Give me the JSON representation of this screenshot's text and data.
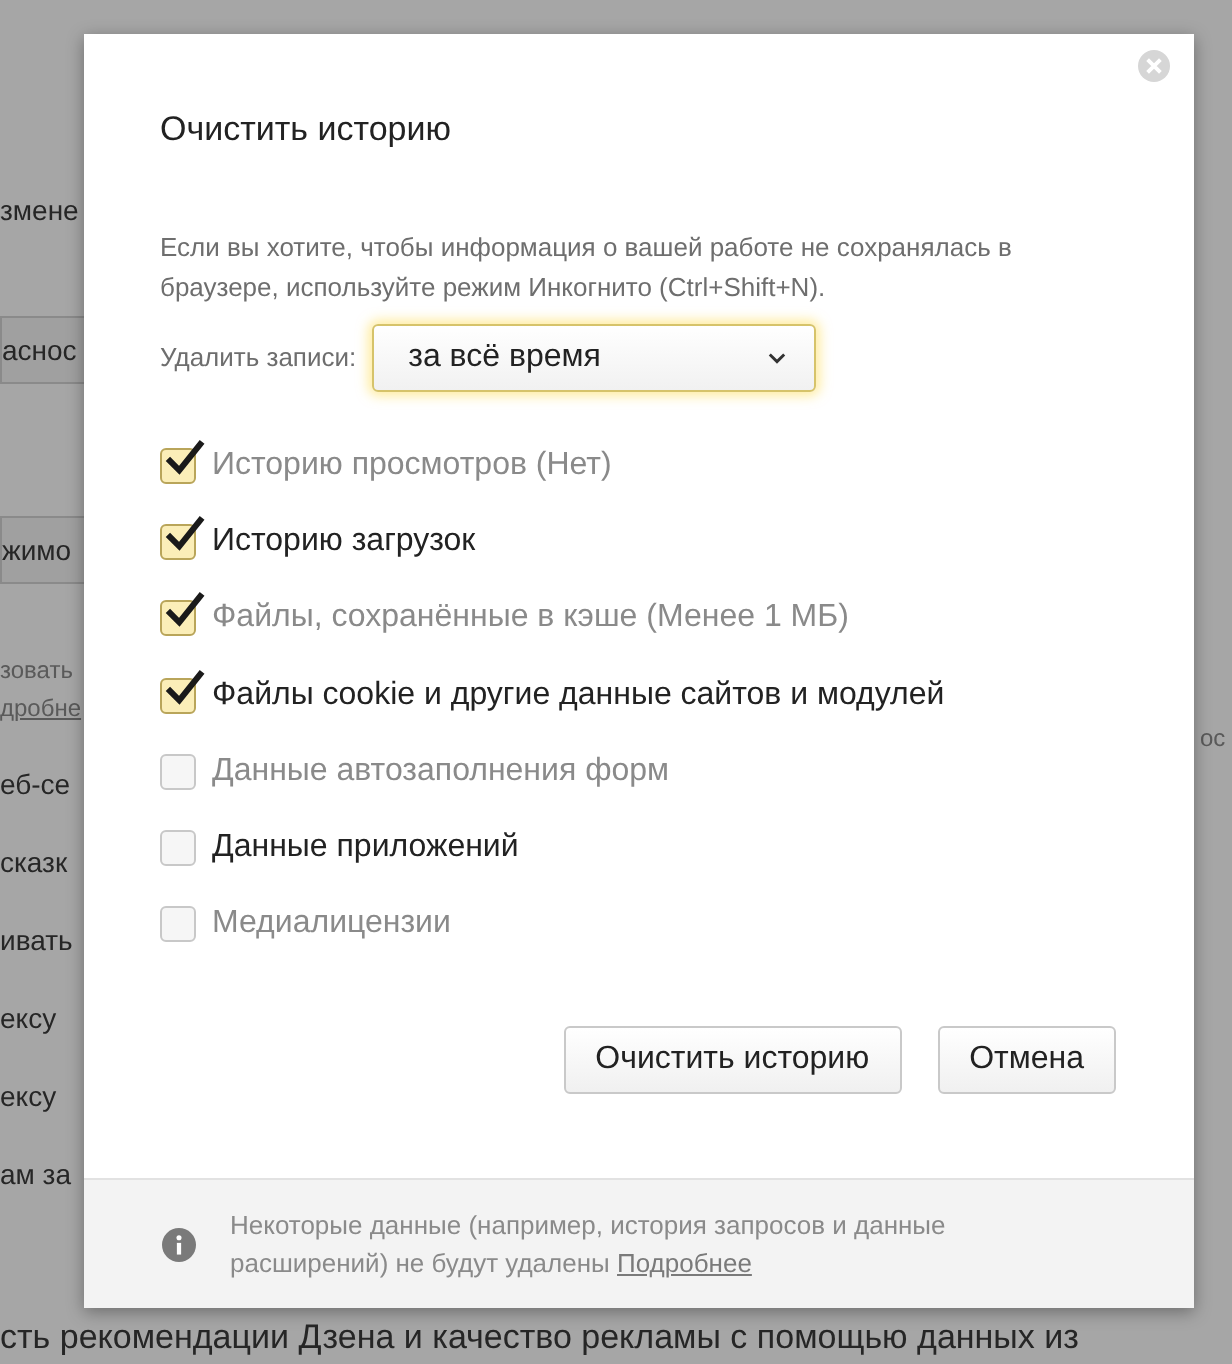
{
  "background": {
    "left_texts": [
      {
        "kind": "text",
        "text": "змене"
      },
      {
        "kind": "button",
        "text": "аснос"
      },
      {
        "kind": "button",
        "text": "жимо"
      },
      {
        "kind": "hint",
        "text": "зовать"
      },
      {
        "kind": "link",
        "text": "дробне"
      },
      {
        "kind": "text",
        "text": "еб-се"
      },
      {
        "kind": "text",
        "text": "сказк"
      },
      {
        "kind": "text",
        "text": "ивать"
      },
      {
        "kind": "text",
        "text": "ексу"
      },
      {
        "kind": "text",
        "text": "ексу"
      },
      {
        "kind": "text",
        "text": "ам за"
      }
    ],
    "right_text": "ос",
    "bottom_text": "сть рекомендации Дзена и качество рекламы с помощью данных из"
  },
  "dialog": {
    "title": "Очистить историю",
    "info": "Если вы хотите, чтобы информация о вашей работе не сохранялась в браузере, используйте режим Инкогнито (Ctrl+Shift+N).",
    "range_label": "Удалить записи:",
    "range_value": "за всё время",
    "items": [
      {
        "label": "Историю просмотров (Нет)",
        "checked": true,
        "dimmed": true
      },
      {
        "label": "Историю загрузок",
        "checked": true,
        "dimmed": false
      },
      {
        "label": "Файлы, сохранённые в кэше (Менее 1 МБ)",
        "checked": true,
        "dimmed": true
      },
      {
        "label": "Файлы cookie и другие данные сайтов и модулей",
        "checked": true,
        "dimmed": false
      },
      {
        "label": "Данные автозаполнения форм",
        "checked": false,
        "dimmed": true
      },
      {
        "label": "Данные приложений",
        "checked": false,
        "dimmed": false
      },
      {
        "label": "Медиалицензии",
        "checked": false,
        "dimmed": true
      }
    ],
    "buttons": [
      "Очистить историю",
      "Отмена"
    ],
    "footer": {
      "text": "Некоторые данные (например, история запросов и данные расширений) не будут удалены",
      "link": "Подробнее"
    }
  }
}
